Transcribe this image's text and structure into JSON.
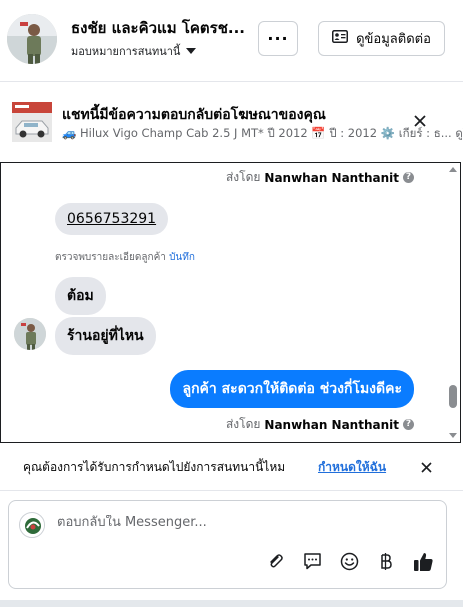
{
  "header": {
    "contact_name": "ธงชัย และคิวแม โคตรช...",
    "assign_label": "มอบหมายการสนทนานี้",
    "more_label": "···",
    "contact_info_label": "ดูข้อมูลติดต่อ"
  },
  "ad": {
    "title": "แชทนี้มีข้อความตอบกลับต่อโฆษณาของคุณ",
    "subtitle": "🚙 Hilux Vigo Champ Cab 2.5 J MT* ปี 2012 📅 ปี : 2012 ⚙️ เกียร์ : ธ... ดูโฆ"
  },
  "chat": {
    "sent_by_prefix": "ส่งโดย",
    "sent_by_name": "Nanwhan Nanthanit",
    "messages": [
      {
        "text": "0656753291"
      },
      {
        "text": "ต้อม"
      },
      {
        "text": "ร้านอยู่ที่ไหน"
      },
      {
        "text": "ลูกค้า สะดวกให้ติดต่อ ช่วงกี่โมงดีคะ"
      }
    ],
    "detail_text": "ตรวจพบรายละเอียดลูกค้า",
    "detail_link": "บันทึก"
  },
  "prompt": {
    "text": "คุณต้องการได้รับการกำหนดไปยังการสนทนานี้ไหม",
    "link": "กำหนดให้ฉัน"
  },
  "composer": {
    "placeholder": "ตอบกลับใน Messenger..."
  },
  "colors": {
    "accent": "#0a7cff",
    "link": "#216fdb",
    "incoming_bubble": "#e4e6eb",
    "secondary_text": "#65676b"
  },
  "icons": [
    "contact-card-icon",
    "close-icon",
    "info-icon",
    "attach-icon",
    "saved-replies-icon",
    "emoji-icon",
    "baht-icon",
    "thumbs-up-icon"
  ]
}
